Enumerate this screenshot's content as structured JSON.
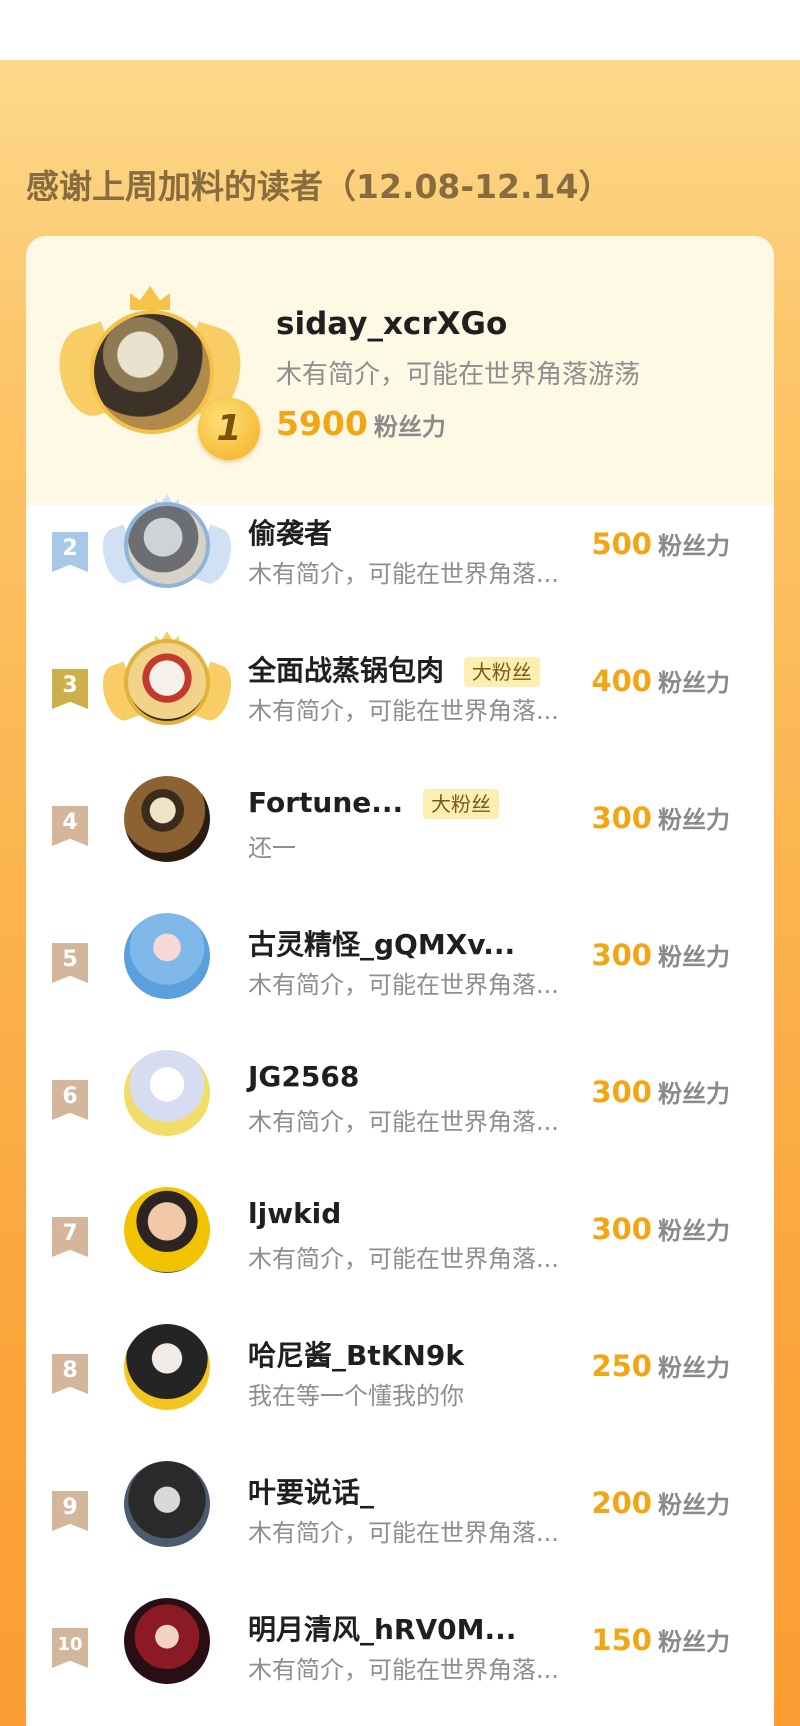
{
  "header_title": "感谢上周加料的读者（12.08-12.14）",
  "unit_label": "粉丝力",
  "champion": {
    "rank": "1",
    "name": "siday_xcrXGo",
    "bio": "木有简介，可能在世界角落游荡",
    "score": "5900"
  },
  "rows": [
    {
      "rank": "2",
      "name": "偷袭者",
      "badge": "",
      "bio": "木有简介，可能在世界角落...",
      "score": "500"
    },
    {
      "rank": "3",
      "name": "全面战蒸锅包肉",
      "badge": "大粉丝",
      "bio": "木有简介，可能在世界角落...",
      "score": "400"
    },
    {
      "rank": "4",
      "name": "Fortune...",
      "badge": "大粉丝",
      "bio": "还一",
      "score": "300"
    },
    {
      "rank": "5",
      "name": "古灵精怪_gQMXv...",
      "badge": "",
      "bio": "木有简介，可能在世界角落...",
      "score": "300"
    },
    {
      "rank": "6",
      "name": "JG2568",
      "badge": "",
      "bio": "木有简介，可能在世界角落...",
      "score": "300"
    },
    {
      "rank": "7",
      "name": "ljwkid",
      "badge": "",
      "bio": "木有简介，可能在世界角落...",
      "score": "300"
    },
    {
      "rank": "8",
      "name": "哈尼酱_BtKN9k",
      "badge": "",
      "bio": "我在等一个懂我的你",
      "score": "250"
    },
    {
      "rank": "9",
      "name": "叶要说话_",
      "badge": "",
      "bio": "木有简介，可能在世界角落...",
      "score": "200"
    },
    {
      "rank": "10",
      "name": "明月清风_hRV0M...",
      "badge": "",
      "bio": "木有简介，可能在世界角落...",
      "score": "150"
    }
  ],
  "colors": {
    "accent_orange": "#f3a514",
    "badge_silver": "#a9c8e8",
    "badge_gold": "#cdb04a",
    "badge_plain": "#d3b69c"
  }
}
